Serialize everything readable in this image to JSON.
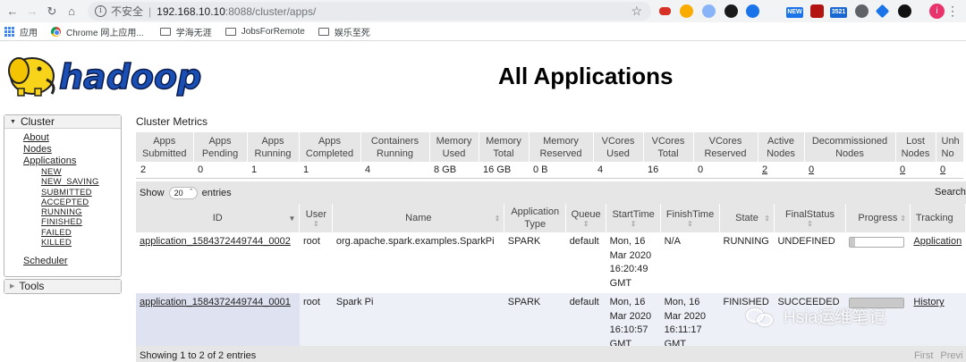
{
  "browser": {
    "security_label": "不安全",
    "url_host": "192.168.10.10",
    "url_rest": ":8088/cluster/apps/",
    "ext_badges": [
      "NEW",
      "3521"
    ],
    "profile_initial": "i"
  },
  "bookmarks": [
    {
      "label": "应用",
      "icon": "apps-grid-icon"
    },
    {
      "label": "Chrome 网上应用...",
      "icon": "chrome-icon"
    },
    {
      "label": "学海无涯",
      "icon": "folder-icon"
    },
    {
      "label": "JobsForRemote",
      "icon": "folder-icon"
    },
    {
      "label": "娱乐至死",
      "icon": "folder-icon"
    }
  ],
  "header": {
    "logo_text": "hadoop",
    "title": "All Applications"
  },
  "sidebar": {
    "cluster_label": "Cluster",
    "links": {
      "about": "About",
      "nodes": "Nodes",
      "applications": "Applications",
      "scheduler": "Scheduler"
    },
    "app_states": [
      "NEW",
      "NEW_SAVING",
      "SUBMITTED",
      "ACCEPTED",
      "RUNNING",
      "FINISHED",
      "FAILED",
      "KILLED"
    ],
    "tools_label": "Tools"
  },
  "metrics": {
    "title": "Cluster Metrics",
    "headers": [
      [
        "Apps",
        "Submitted"
      ],
      [
        "Apps",
        "Pending"
      ],
      [
        "Apps",
        "Running"
      ],
      [
        "Apps",
        "Completed"
      ],
      [
        "Containers",
        "Running"
      ],
      [
        "Memory",
        "Used"
      ],
      [
        "Memory",
        "Total"
      ],
      [
        "Memory",
        "Reserved"
      ],
      [
        "VCores",
        "Used"
      ],
      [
        "VCores",
        "Total"
      ],
      [
        "VCores",
        "Reserved"
      ],
      [
        "Active",
        "Nodes"
      ],
      [
        "Decommissioned",
        "Nodes"
      ],
      [
        "Lost",
        "Nodes"
      ],
      [
        "Unh",
        "No"
      ]
    ],
    "values": [
      "2",
      "0",
      "1",
      "1",
      "4",
      "8 GB",
      "16 GB",
      "0 B",
      "4",
      "16",
      "0",
      "2",
      "0",
      "0",
      "0"
    ]
  },
  "apps_table": {
    "show_label": "Show",
    "page_size": "20",
    "entries_label": "entries",
    "search_label": "Search",
    "headers": {
      "id": "ID",
      "user": "User",
      "name": "Name",
      "app_type": [
        "Application",
        "Type"
      ],
      "queue": "Queue",
      "start": "StartTime",
      "finish": "FinishTime",
      "state": "State",
      "final_status": "FinalStatus",
      "progress": "Progress",
      "tracking": "Tracking"
    },
    "rows": [
      {
        "id": "application_1584372449744_0002",
        "user": "root",
        "name": "org.apache.spark.examples.SparkPi",
        "type": "SPARK",
        "queue": "default",
        "start": [
          "Mon, 16",
          "Mar 2020",
          "16:20:49",
          "GMT"
        ],
        "finish": [
          "N/A"
        ],
        "state": "RUNNING",
        "final_status": "UNDEFINED",
        "progress": 0.1,
        "tracking": "Application"
      },
      {
        "id": "application_1584372449744_0001",
        "user": "root",
        "name": "Spark Pi",
        "type": "SPARK",
        "queue": "default",
        "start": [
          "Mon, 16",
          "Mar 2020",
          "16:10:57",
          "GMT"
        ],
        "finish": [
          "Mon, 16",
          "Mar 2020",
          "16:11:17",
          "GMT"
        ],
        "state": "FINISHED",
        "final_status": "SUCCEEDED",
        "progress": 1.0,
        "tracking": "History"
      }
    ],
    "info": "Showing 1 to 2 of 2 entries",
    "pager": [
      "First",
      "Previ"
    ]
  },
  "watermark": "Hsia运维笔记"
}
